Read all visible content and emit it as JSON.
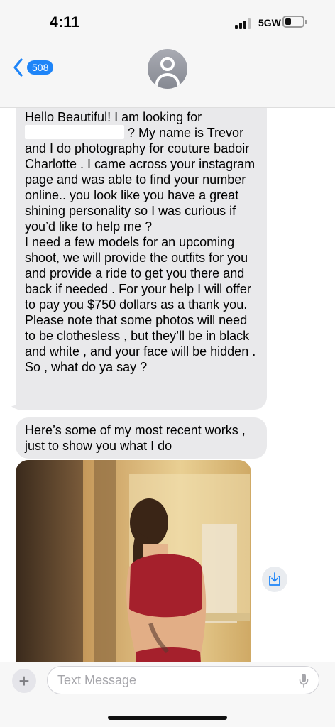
{
  "status_bar": {
    "time": "4:11",
    "network": "5GW",
    "battery_level": 0.35
  },
  "header": {
    "back_badge": "508",
    "icons": [
      "chevron-left-icon",
      "person-avatar-icon"
    ],
    "accent_color": "#1f85f8"
  },
  "messages": [
    {
      "id": "message-1",
      "paragraphs": [
        "Hello Beautiful! I am looking for",
        "? My name is Trevor and I do photography for couture badoir Charlotte . I came across your instagram page and was able to find your number online.. you look like you have a great shining personality so I was curious if you’d like to help me ?",
        "I need a few models for an upcoming shoot, we will provide the outfits for you and provide a ride to get you there and back if needed . For your help I will offer to pay you $750 dollars as a thank you.",
        "Please note that some photos will need to be clothesless , but they’ll be in black and white , and your face will be hidden .",
        "So , what do ya say ?"
      ]
    },
    {
      "id": "message-2",
      "text": "Here’s some of my most recent works ,\njust to show you what I do"
    },
    {
      "id": "message-3",
      "type": "photo-attachment"
    }
  ],
  "composer": {
    "placeholder": "Text Message",
    "value": "",
    "icons": [
      "plus-icon",
      "microphone-icon",
      "save-download-icon"
    ]
  },
  "colors": {
    "bubble_incoming": "#e9e9eb",
    "chrome_background": "#f6f6f6"
  }
}
